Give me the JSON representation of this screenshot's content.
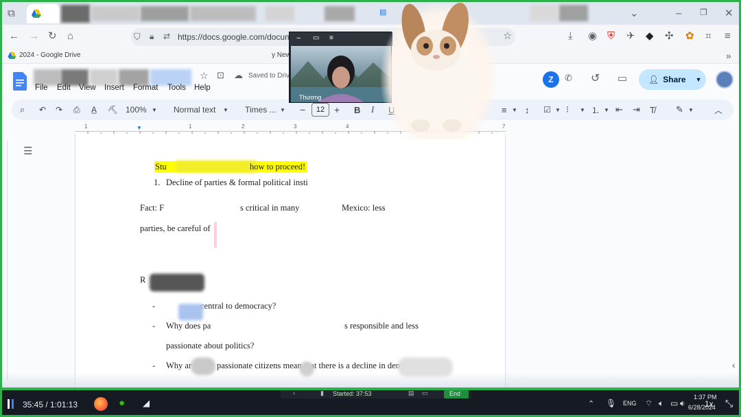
{
  "browser": {
    "tab_label": "2024 - Google Drive",
    "url": "https://docs.google.com/documen",
    "bookmark_label": "y New"
  },
  "docs": {
    "menu": [
      "File",
      "Edit",
      "View",
      "Insert",
      "Format",
      "Tools",
      "Help"
    ],
    "saved_status": "Saved to Drive",
    "share_label": "Share",
    "account_initial": "Z"
  },
  "toolbar": {
    "zoom": "100%",
    "style": "Normal text",
    "font": "Times ...",
    "font_size": "12"
  },
  "ruler": {
    "ticks": [
      "1",
      "1",
      "2",
      "3",
      "4",
      "7"
    ]
  },
  "video_overlay": {
    "participant_name": "Thương"
  },
  "document": {
    "line1": "Stuck … how to proceed!",
    "line1_a": "Stu",
    "line1_b": "how to proceed!",
    "list_item1_num": "1.",
    "list_item1": "Decline of parties & formal political insti",
    "para1_a": "Fact: F",
    "para1_b": "s critical in many",
    "para1_c": "Mexico: less",
    "para2": "parties, be careful of",
    "heading_r": "R",
    "bullet1": "central to democracy?",
    "bullet2_a": "Why does pa",
    "bullet2_b": "s responsible and less",
    "bullet2_c": "passionate about politics?",
    "bullet3_a": "Why ar",
    "bullet3_b": "passionate citizens mean that there is a decline in dem"
  },
  "recorder": {
    "started_label": "Started: 37:53",
    "end_label": "End"
  },
  "taskbar": {
    "timer": "35:45 / 1:01:13",
    "language": "ENG",
    "time": "1:37 PM",
    "date": "6/28/2024",
    "speed": "1x"
  }
}
